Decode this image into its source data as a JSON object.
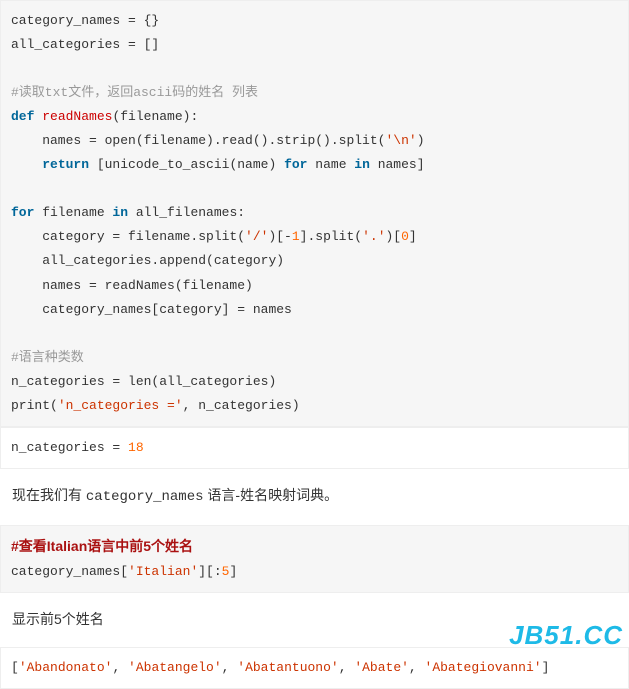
{
  "block1": {
    "l1": "category_names = {}",
    "l2": "all_categories = []",
    "l3": "",
    "l4_comment": "#读取txt文件，返回ascii码的姓名 列表",
    "l5_pre": "def ",
    "l5_func": "readNames",
    "l5_post": "(filename):",
    "l6_a": "    names = open(filename).read().strip().split(",
    "l6_str": "'\\n'",
    "l6_b": ")",
    "l7_a": "    ",
    "l7_kw": "return",
    "l7_b": " [unicode_to_ascii(name) ",
    "l7_for": "for",
    "l7_c": " name ",
    "l7_in": "in",
    "l7_d": " names]",
    "l8": "",
    "l9_a": "for",
    "l9_b": " filename ",
    "l9_in": "in",
    "l9_c": " all_filenames:",
    "l10_a": "    category = filename.split(",
    "l10_s1": "'/'",
    "l10_b": ")[-",
    "l10_n1": "1",
    "l10_c": "].split(",
    "l10_s2": "'.'",
    "l10_d": ")[",
    "l10_n2": "0",
    "l10_e": "]",
    "l11": "    all_categories.append(category)",
    "l12": "    names = readNames(filename)",
    "l13": "    category_names[category] = names",
    "l14": "",
    "l15_comment": "#语言种类数",
    "l16": "n_categories = len(all_categories)",
    "l17_a": "print(",
    "l17_str": "'n_categories ='",
    "l17_b": ", n_categories)"
  },
  "output1": {
    "a": "n_categories = ",
    "n": "18"
  },
  "prose1": {
    "a": "现在我们有 ",
    "b": "category_names",
    "c": " 语言-姓名映射词典。"
  },
  "block2": {
    "heading": "#查看Italian语言中前5个姓名",
    "l2_a": "category_names[",
    "l2_s": "'Italian'",
    "l2_b": "][:",
    "l2_n": "5",
    "l2_c": "]"
  },
  "prose2": "显示前5个姓名",
  "output2": {
    "a": "[",
    "s1": "'Abandonato'",
    "c1": ", ",
    "s2": "'Abatangelo'",
    "c2": ", ",
    "s3": "'Abatantuono'",
    "c3": ", ",
    "s4": "'Abate'",
    "c4": ", ",
    "s5": "'Abategiovanni'",
    "b": "]"
  },
  "watermark": "JB51.CC"
}
